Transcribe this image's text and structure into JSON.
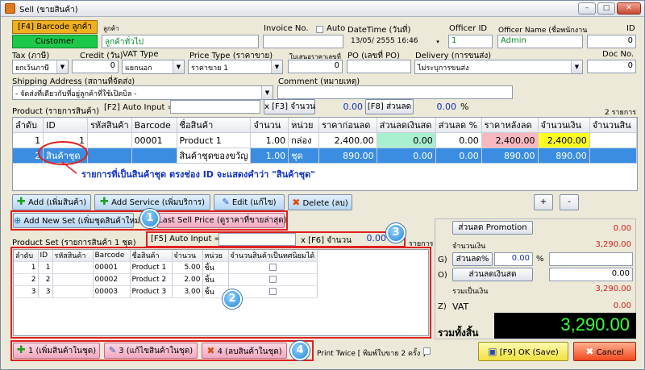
{
  "window": {
    "title": "Sell (ขายสินค้า)",
    "min_label": "–",
    "max_label": "□",
    "close_label": "✕"
  },
  "header": {
    "barcode_label": "[F4] Barcode ลูกค้า",
    "customer_label": "ลูกค้า",
    "customer_btn": "Customer",
    "customer_name": "ลูกค้าทั่วไป",
    "invoice_label": "Invoice No.",
    "auto_label": "Auto",
    "datetime_label": "DateTime (วันที่)",
    "datetime_value": "13/05/ 2555 16:46",
    "officer_id_label": "Officer ID",
    "officer_id_value": "1",
    "officer_name_label": "Officer Name (ชื่อพนักงาน",
    "officer_name_value": "Admin",
    "id_label": "ID",
    "id_value": "0"
  },
  "row2": {
    "tax_label": "Tax (ภาษี)",
    "tax_value": "ยกเว้นภาษี",
    "credit_label": "Credit (วัน)",
    "credit_value": "0",
    "vat_label": "VAT Type",
    "vat_value": "แยกนอก",
    "price_label": "Price Type (ราคาขาย)",
    "price_value": "ราคาขาย 1",
    "quote_label": "ใบเสนอราคาเลขที่",
    "quote_value": "0",
    "po_label": "PO (เลขที่ PO)",
    "delivery_label": "Delivery (การขนส่ง)",
    "delivery_value": "ไม่ระบุการขนส่ง",
    "doc_label": "Doc No.",
    "doc_value": "0"
  },
  "row3": {
    "shipping_label": "Shipping Address (สถานที่จัดส่ง)",
    "shipping_value": "- จัดส่งที่เดียวกับที่อยู่ลูกค้าที่ใช้เปิดบิล -",
    "comment_label": "Comment (หมายเหตุ)"
  },
  "product_bar": {
    "label": "Product (รายการสินค้า)",
    "f2_label": "[F2] Auto Input =>",
    "f3_label": "x [F3] จำนวน",
    "f3_value": "0.00",
    "f8_label": "[F8] ส่วนลด",
    "f8_value": "0.00",
    "pct": "%",
    "count": "2 รายการ"
  },
  "grid1": {
    "headers": [
      "ลำดับ",
      "ID",
      "รหัสสินค้า",
      "Barcode",
      "ชื่อสินค้า",
      "จำนวน",
      "หน่วย",
      "ราคาก่อนลด",
      "ส่วนลดเงินสด",
      "ส่วนลด %",
      "ราคาหลังลด",
      "จำนวนเงิน",
      "จำนวนสิน"
    ],
    "rows": [
      [
        "1",
        "1",
        "",
        "00001",
        "Product 1",
        "1.00",
        "กล่อง",
        "2,400.00",
        "0.00",
        "0.00",
        "2,400.00",
        "2,400.00",
        ""
      ],
      [
        "2",
        "สินค้าชุด",
        "",
        "",
        "สินค้าชุดของขวัญ",
        "1.00",
        "ชุด",
        "890.00",
        "0.00",
        "0.00",
        "890.00",
        "890.00",
        ""
      ]
    ],
    "annotation": "รายการที่เป็นสินค้าชุด ตรงช่อง ID จะแสดงคำว่า \"สินค้าชุด\""
  },
  "actions": {
    "add": "Add (เพิ่มสินค้า)",
    "add_service": "Add Service (เพิ่มบริการ)",
    "edit": "Edit (แก้ไข)",
    "delete": "Delete (ลบ)",
    "plus": "+",
    "minus": "-",
    "add_new_set": "Add New Set (เพิ่มชุดสินค้าใหม่)",
    "last_sell_price": "Last Sell Price (ดูราคาที่ขายล่าสุด)"
  },
  "callouts": [
    "1",
    "2",
    "3",
    "4"
  ],
  "set_bar": {
    "label": "Product Set (รายการสินค้า 1 ชุด)",
    "f5_label": "[F5] Auto Input =>",
    "f6_label": "x [F6] จำนวน",
    "f6_value": "0.00",
    "suffix": "รายการ"
  },
  "grid2": {
    "headers": [
      "ลำดับ",
      "ID",
      "รหัสสินค้า",
      "Barcode",
      "ชื่อสินค้า",
      "จำนวน",
      "หน่วย",
      "จำนวนสินค้าเป็นทศนิยมได้"
    ],
    "rows": [
      [
        "1",
        "1",
        "",
        "00001",
        "Product 1",
        "5.00",
        "ชิ้น"
      ],
      [
        "2",
        "2",
        "",
        "00002",
        "Product 2",
        "2.00",
        "ชิ้น"
      ],
      [
        "3",
        "3",
        "",
        "00003",
        "Product 3",
        "3.00",
        "ชิ้น"
      ]
    ]
  },
  "set_actions": {
    "b1": "1 (เพิ่มสินค้าในชุด)",
    "b3": "3 (แก้ไขสินค้าในชุด)",
    "b4": "4 (ลบสินค้าในชุด)",
    "print_twice": "Print Twice [ พิมพ์ใบขาย 2 ครั้ง ]"
  },
  "summary": {
    "promo_btn": "ส่วนลด Promotion",
    "promo_value": "0.00",
    "subtotal_label": "จำนวนเงิน",
    "subtotal_value": "3,290.00",
    "g_label": "G)",
    "pct_btn": "ส่วนลด%",
    "pct_value": "0.00",
    "pct_sign": "%",
    "o_label": "O)",
    "cash_btn": "ส่วนลดเงินสด",
    "cash_value": "0.00",
    "net_label": "รวมเป็นเงิน",
    "net_value": "3,290.00",
    "z_label": "Z)",
    "vat_label": "VAT",
    "vat_value": "0.00",
    "total_label": "รวมทั้งสิ้น",
    "total_value": "3,290.00"
  },
  "footer": {
    "ok": "[F9] OK (Save)",
    "cancel": "Cancel"
  },
  "colors": {
    "accent_green": "#0a8a2a",
    "selected_row": "#3a8de0",
    "total_bg": "#000000",
    "total_fg": "#3cff3c",
    "discount_cell": "#a8f0d0",
    "after_discount_cell": "#f8b8c0",
    "amount_cell": "#ffff20",
    "callout_blue": "#2a8ad8",
    "annotation_blue": "#1030c0"
  }
}
